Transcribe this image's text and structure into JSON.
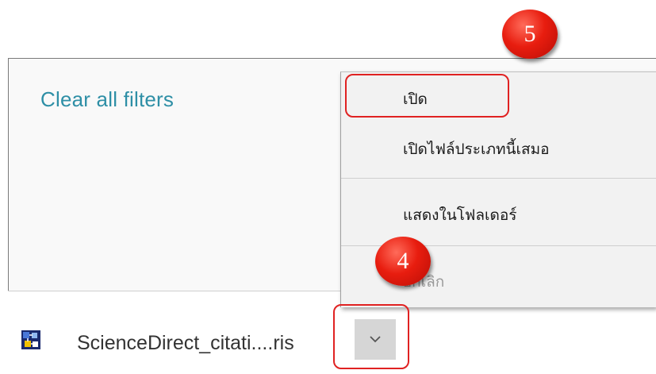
{
  "sidebar": {
    "clear_filters": "Clear all filters"
  },
  "context_menu": {
    "items": [
      {
        "label": "เปิด"
      },
      {
        "label": "เปิดไฟล์ประเภทนี้เสมอ"
      },
      {
        "label": "แสดงในโฟลเดอร์"
      },
      {
        "label": "ยกเลิก"
      }
    ]
  },
  "download_bar": {
    "file_name": "ScienceDirect_citati....ris",
    "file_icon": "ris-file-icon",
    "options_icon": "chevron-down-icon"
  },
  "annotations": {
    "step_open": "5",
    "step_arrow": "4",
    "highlight_color": "#e02222",
    "badge_color": "#e81d0f"
  },
  "colors": {
    "link": "#2e8fa6",
    "menu_bg": "#f2f2f2"
  }
}
